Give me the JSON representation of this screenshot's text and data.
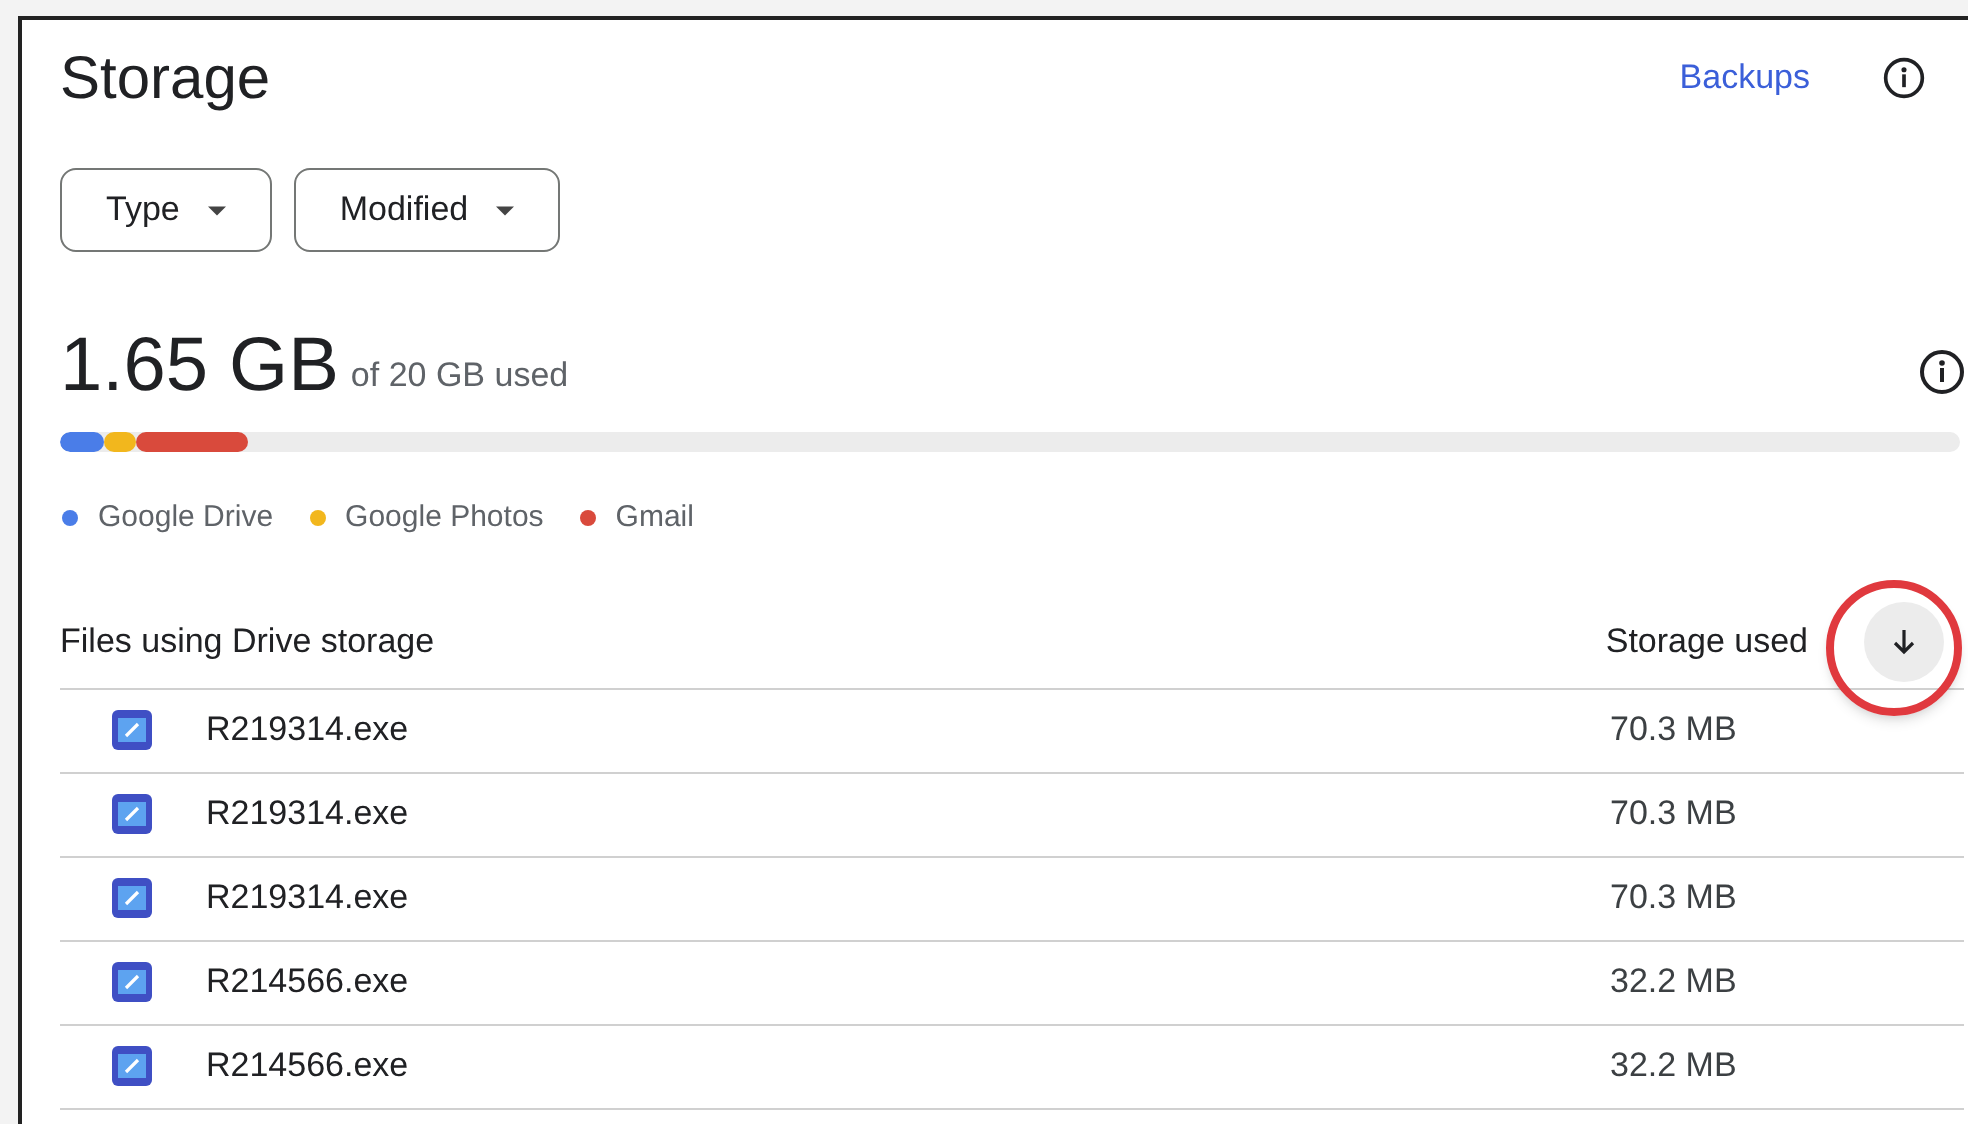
{
  "title": "Storage",
  "header_link": "Backups",
  "filters": [
    {
      "label": "Type"
    },
    {
      "label": "Modified"
    }
  ],
  "usage": {
    "amount": "1.65 GB",
    "caption": "of 20 GB used"
  },
  "usage_bar": {
    "segments": [
      {
        "color": "#4a7de8",
        "level": 0.023
      },
      {
        "color": "#f2b71d",
        "level": 0.017
      },
      {
        "color": "#d94a3c",
        "level": 0.059
      }
    ]
  },
  "legend": [
    {
      "label": "Google Drive",
      "color": "#4a7de8"
    },
    {
      "label": "Google Photos",
      "color": "#f2b71d"
    },
    {
      "label": "Gmail",
      "color": "#d94a3c"
    }
  ],
  "table": {
    "columns": [
      "Files using Drive storage",
      "Storage used"
    ],
    "sort": {
      "descending": true,
      "highlighted": true
    },
    "rows": [
      {
        "name": "R219314.exe",
        "size": "70.3 MB"
      },
      {
        "name": "R219314.exe",
        "size": "70.3 MB"
      },
      {
        "name": "R219314.exe",
        "size": "70.3 MB"
      },
      {
        "name": "R214566.exe",
        "size": "32.2 MB"
      },
      {
        "name": "R214566.exe",
        "size": "32.2 MB"
      }
    ]
  }
}
